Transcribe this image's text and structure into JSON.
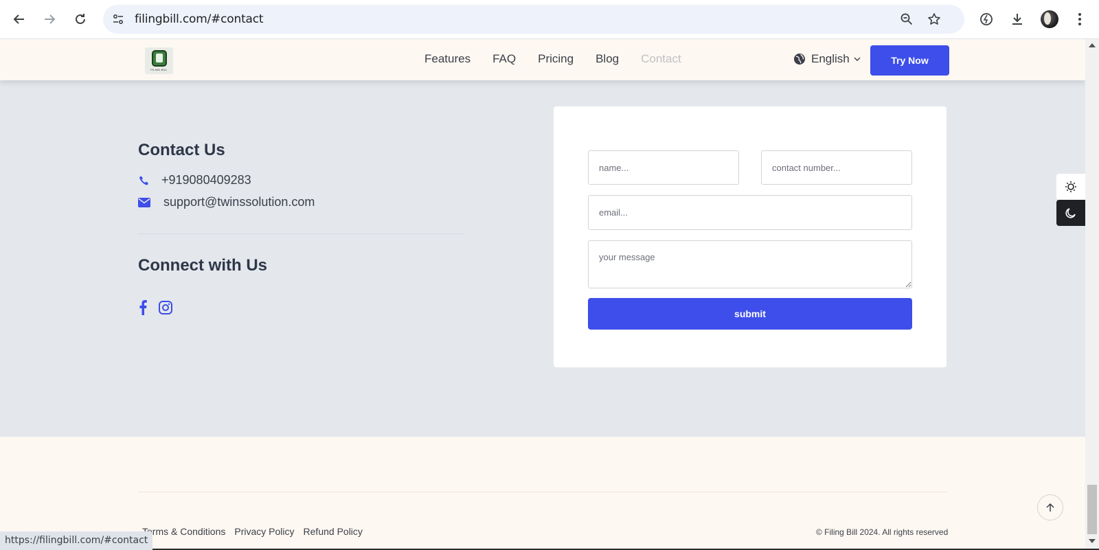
{
  "browser": {
    "url": "filingbill.com/#contact",
    "status_url": "https://filingbill.com/#contact"
  },
  "header": {
    "logo_text": "FILING BILL",
    "nav": [
      {
        "label": "Features",
        "active": false
      },
      {
        "label": "FAQ",
        "active": false
      },
      {
        "label": "Pricing",
        "active": false
      },
      {
        "label": "Blog",
        "active": false
      },
      {
        "label": "Contact",
        "active": true
      }
    ],
    "language": "English",
    "try_now": "Try Now"
  },
  "contact": {
    "title": "Contact Us",
    "phone": "+919080409283",
    "email": "support@twinssolution.com",
    "connect_title": "Connect with Us",
    "socials": [
      "facebook-icon",
      "instagram-icon"
    ]
  },
  "form": {
    "name_placeholder": "name...",
    "contact_placeholder": "contact number...",
    "email_placeholder": "email...",
    "message_placeholder": "your message",
    "submit_label": "submit"
  },
  "footer": {
    "links": [
      "Terms & Conditions",
      "Privacy Policy",
      "Refund Policy"
    ],
    "copyright": "© Filing Bill 2024. All rights reserved"
  },
  "colors": {
    "accent": "#3d4eea",
    "page_bg": "#e4e7ec",
    "header_bg": "#fdf8f1",
    "nav_active": "#bfc1c6"
  }
}
